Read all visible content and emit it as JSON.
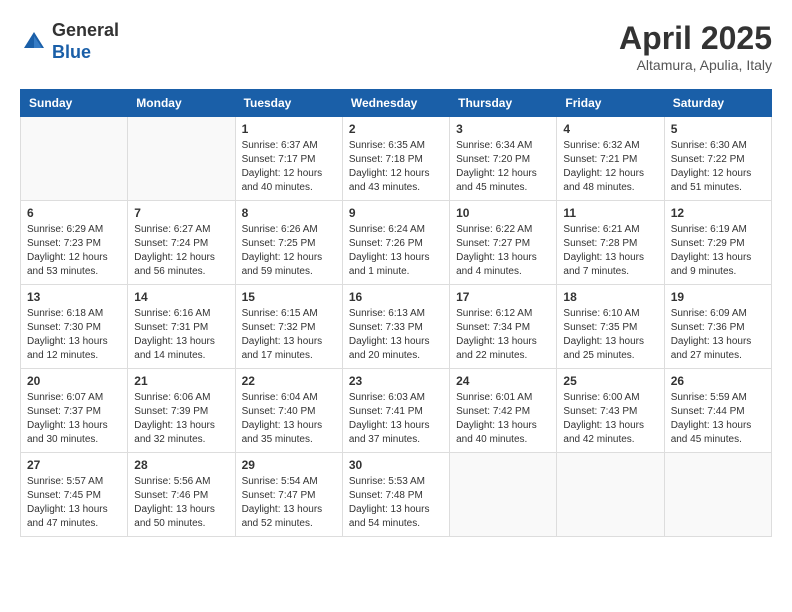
{
  "header": {
    "logo_general": "General",
    "logo_blue": "Blue",
    "month_title": "April 2025",
    "location": "Altamura, Apulia, Italy"
  },
  "weekdays": [
    "Sunday",
    "Monday",
    "Tuesday",
    "Wednesday",
    "Thursday",
    "Friday",
    "Saturday"
  ],
  "weeks": [
    [
      null,
      null,
      {
        "day": "1",
        "sunrise": "6:37 AM",
        "sunset": "7:17 PM",
        "daylight": "12 hours and 40 minutes."
      },
      {
        "day": "2",
        "sunrise": "6:35 AM",
        "sunset": "7:18 PM",
        "daylight": "12 hours and 43 minutes."
      },
      {
        "day": "3",
        "sunrise": "6:34 AM",
        "sunset": "7:20 PM",
        "daylight": "12 hours and 45 minutes."
      },
      {
        "day": "4",
        "sunrise": "6:32 AM",
        "sunset": "7:21 PM",
        "daylight": "12 hours and 48 minutes."
      },
      {
        "day": "5",
        "sunrise": "6:30 AM",
        "sunset": "7:22 PM",
        "daylight": "12 hours and 51 minutes."
      }
    ],
    [
      {
        "day": "6",
        "sunrise": "6:29 AM",
        "sunset": "7:23 PM",
        "daylight": "12 hours and 53 minutes."
      },
      {
        "day": "7",
        "sunrise": "6:27 AM",
        "sunset": "7:24 PM",
        "daylight": "12 hours and 56 minutes."
      },
      {
        "day": "8",
        "sunrise": "6:26 AM",
        "sunset": "7:25 PM",
        "daylight": "12 hours and 59 minutes."
      },
      {
        "day": "9",
        "sunrise": "6:24 AM",
        "sunset": "7:26 PM",
        "daylight": "13 hours and 1 minute."
      },
      {
        "day": "10",
        "sunrise": "6:22 AM",
        "sunset": "7:27 PM",
        "daylight": "13 hours and 4 minutes."
      },
      {
        "day": "11",
        "sunrise": "6:21 AM",
        "sunset": "7:28 PM",
        "daylight": "13 hours and 7 minutes."
      },
      {
        "day": "12",
        "sunrise": "6:19 AM",
        "sunset": "7:29 PM",
        "daylight": "13 hours and 9 minutes."
      }
    ],
    [
      {
        "day": "13",
        "sunrise": "6:18 AM",
        "sunset": "7:30 PM",
        "daylight": "13 hours and 12 minutes."
      },
      {
        "day": "14",
        "sunrise": "6:16 AM",
        "sunset": "7:31 PM",
        "daylight": "13 hours and 14 minutes."
      },
      {
        "day": "15",
        "sunrise": "6:15 AM",
        "sunset": "7:32 PM",
        "daylight": "13 hours and 17 minutes."
      },
      {
        "day": "16",
        "sunrise": "6:13 AM",
        "sunset": "7:33 PM",
        "daylight": "13 hours and 20 minutes."
      },
      {
        "day": "17",
        "sunrise": "6:12 AM",
        "sunset": "7:34 PM",
        "daylight": "13 hours and 22 minutes."
      },
      {
        "day": "18",
        "sunrise": "6:10 AM",
        "sunset": "7:35 PM",
        "daylight": "13 hours and 25 minutes."
      },
      {
        "day": "19",
        "sunrise": "6:09 AM",
        "sunset": "7:36 PM",
        "daylight": "13 hours and 27 minutes."
      }
    ],
    [
      {
        "day": "20",
        "sunrise": "6:07 AM",
        "sunset": "7:37 PM",
        "daylight": "13 hours and 30 minutes."
      },
      {
        "day": "21",
        "sunrise": "6:06 AM",
        "sunset": "7:39 PM",
        "daylight": "13 hours and 32 minutes."
      },
      {
        "day": "22",
        "sunrise": "6:04 AM",
        "sunset": "7:40 PM",
        "daylight": "13 hours and 35 minutes."
      },
      {
        "day": "23",
        "sunrise": "6:03 AM",
        "sunset": "7:41 PM",
        "daylight": "13 hours and 37 minutes."
      },
      {
        "day": "24",
        "sunrise": "6:01 AM",
        "sunset": "7:42 PM",
        "daylight": "13 hours and 40 minutes."
      },
      {
        "day": "25",
        "sunrise": "6:00 AM",
        "sunset": "7:43 PM",
        "daylight": "13 hours and 42 minutes."
      },
      {
        "day": "26",
        "sunrise": "5:59 AM",
        "sunset": "7:44 PM",
        "daylight": "13 hours and 45 minutes."
      }
    ],
    [
      {
        "day": "27",
        "sunrise": "5:57 AM",
        "sunset": "7:45 PM",
        "daylight": "13 hours and 47 minutes."
      },
      {
        "day": "28",
        "sunrise": "5:56 AM",
        "sunset": "7:46 PM",
        "daylight": "13 hours and 50 minutes."
      },
      {
        "day": "29",
        "sunrise": "5:54 AM",
        "sunset": "7:47 PM",
        "daylight": "13 hours and 52 minutes."
      },
      {
        "day": "30",
        "sunrise": "5:53 AM",
        "sunset": "7:48 PM",
        "daylight": "13 hours and 54 minutes."
      },
      null,
      null,
      null
    ]
  ]
}
